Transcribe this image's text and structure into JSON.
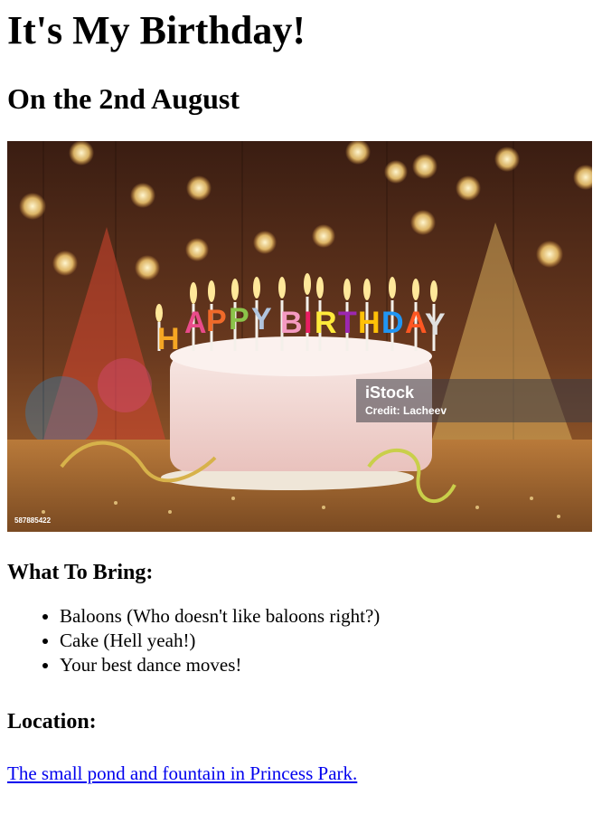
{
  "page": {
    "title": "It's My Birthday!",
    "date_heading": "On the 2nd August"
  },
  "hero_image": {
    "description_icon": "birthday-cake-photo",
    "cake_lettering": "HAPPY BIRTHDAY",
    "watermark_brand": "iStock",
    "watermark_credit": "Credit: Lacheev",
    "stock_id": "587885422"
  },
  "bring": {
    "heading": "What To Bring:",
    "items": [
      "Baloons (Who doesn't like baloons right?)",
      "Cake (Hell yeah!)",
      "Your best dance moves!"
    ]
  },
  "location": {
    "heading": "Location:",
    "link_text": "The small pond and fountain in Princess Park."
  },
  "colors": {
    "link": "#0000ee",
    "text": "#000000",
    "background": "#ffffff"
  }
}
